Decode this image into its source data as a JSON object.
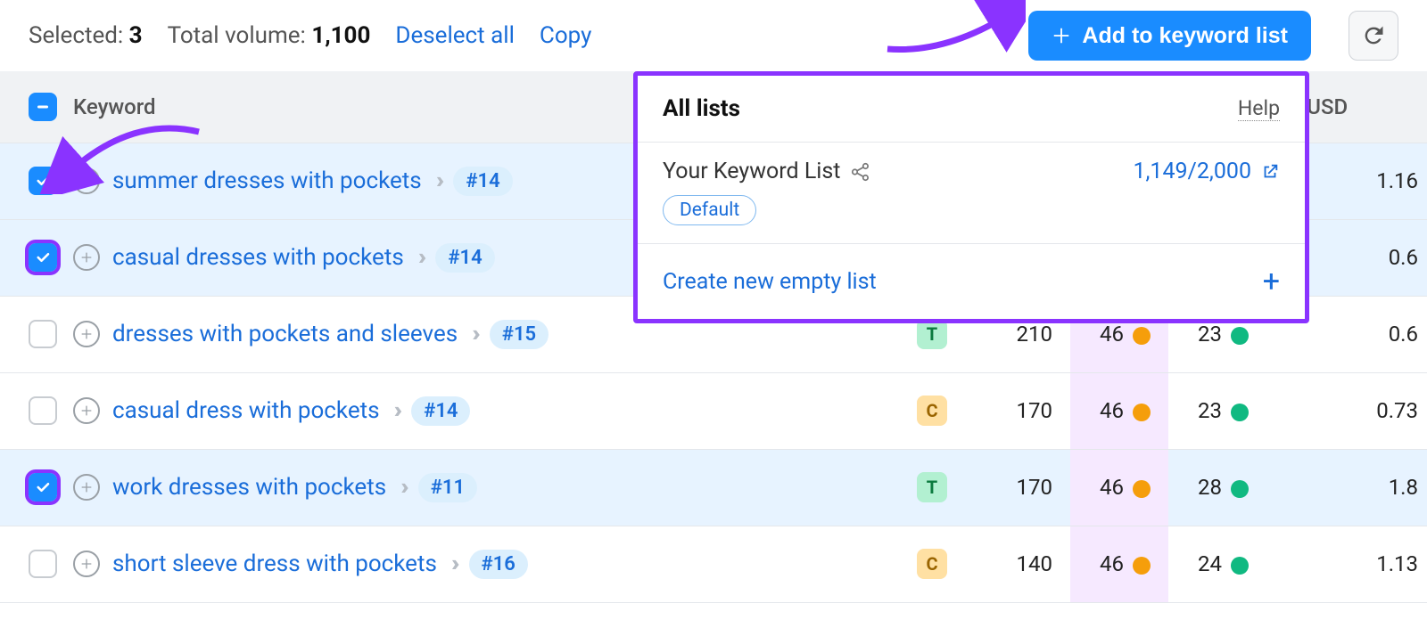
{
  "toolbar": {
    "selected_label": "Selected:",
    "selected_count": "3",
    "volume_label": "Total volume:",
    "volume_value": "1,100",
    "deselect": "Deselect all",
    "copy": "Copy",
    "add_button": "Add to keyword list"
  },
  "colors": {
    "accent": "#1a8cff",
    "annotation": "#8a33ff"
  },
  "popover": {
    "title": "All lists",
    "help": "Help",
    "list_name": "Your Keyword List",
    "count": "1,149/2,000",
    "default_chip": "Default",
    "create": "Create new empty list"
  },
  "columns": {
    "keyword": "Keyword",
    "cpc": "PC (USD"
  },
  "rows": [
    {
      "checked": true,
      "hl": false,
      "kw": "summer dresses with pockets",
      "serp": "#14",
      "intent": "",
      "vol": "",
      "kd": "",
      "com": "",
      "cpc": "1.16"
    },
    {
      "checked": true,
      "hl": true,
      "kw": "casual dresses with pockets",
      "serp": "#14",
      "intent": "",
      "vol": "",
      "kd": "",
      "com": "",
      "cpc": "0.6"
    },
    {
      "checked": false,
      "hl": false,
      "kw": "dresses with pockets and sleeves",
      "serp": "#15",
      "intent": "T",
      "vol": "210",
      "kd": "46",
      "com": "23",
      "cpc": "0.6"
    },
    {
      "checked": false,
      "hl": false,
      "kw": "casual dress with pockets",
      "serp": "#14",
      "intent": "C",
      "vol": "170",
      "kd": "46",
      "com": "23",
      "cpc": "0.73"
    },
    {
      "checked": true,
      "hl": true,
      "kw": "work dresses with pockets",
      "serp": "#11",
      "intent": "T",
      "vol": "170",
      "kd": "46",
      "com": "28",
      "cpc": "1.8"
    },
    {
      "checked": false,
      "hl": false,
      "kw": "short sleeve dress with pockets",
      "serp": "#16",
      "intent": "C",
      "vol": "140",
      "kd": "46",
      "com": "24",
      "cpc": "1.13"
    }
  ]
}
